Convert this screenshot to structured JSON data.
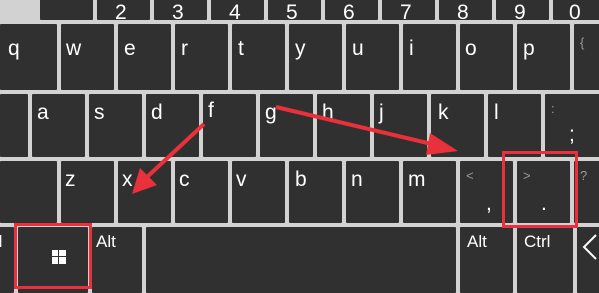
{
  "colors": {
    "key_bg": "#303030",
    "key_text": "#ffffff",
    "key_sub_text": "#9a9a9a",
    "gap": "#d2d2d2",
    "annotation": "#e8313a"
  },
  "number_row": [
    "2",
    "3",
    "4",
    "5",
    "6",
    "7",
    "8",
    "9",
    "0"
  ],
  "row_q": [
    "q",
    "w",
    "e",
    "r",
    "t",
    "y",
    "u",
    "i",
    "o",
    "p"
  ],
  "row_q_edge": "{",
  "row_a": [
    "a",
    "s",
    "d",
    "f",
    "g",
    "h",
    "j",
    "k",
    "l"
  ],
  "semicolon_key": {
    "top": ":",
    "main": ";"
  },
  "row_z": [
    "z",
    "x",
    "c",
    "v",
    "b",
    "n",
    "m"
  ],
  "comma_key": {
    "top": "<",
    "main": ","
  },
  "period_key": {
    "top": ">",
    "main": "."
  },
  "slash_key_top": "?",
  "bottom_row": {
    "left_ctrl_fragment": "rl",
    "windows_key_icon": "windows-logo-icon",
    "left_alt": "Alt",
    "right_alt": "Alt",
    "right_ctrl": "Ctrl",
    "left_arrow_icon": "chevron-left-icon"
  },
  "annotations": {
    "highlighted_keys": [
      "windows-key",
      "period-key"
    ],
    "arrows": [
      "arrow-to-period-key",
      "arrow-to-windows-key"
    ]
  }
}
